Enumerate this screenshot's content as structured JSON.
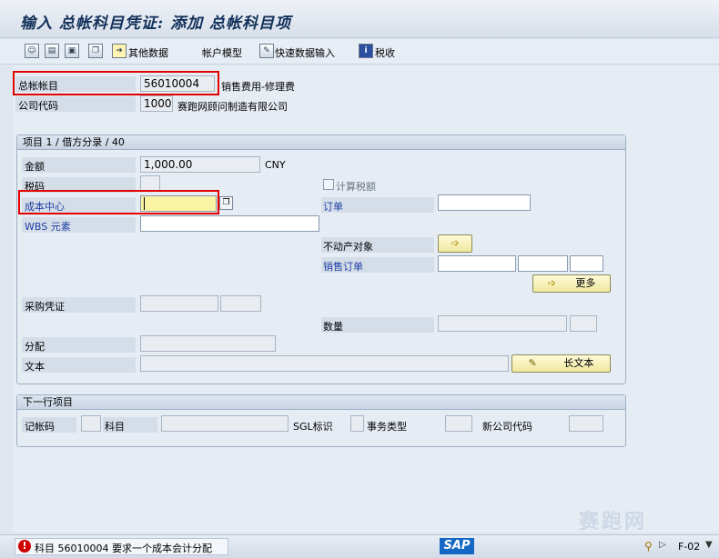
{
  "window": {
    "title": "输入 总帐科目凭证: 添加 总帐科目项"
  },
  "toolbar": {
    "other_data": "其他数据",
    "account_model": "帐户模型",
    "fast_entry": "快速数据输入",
    "tax": "税收"
  },
  "header": {
    "gl_account_label": "总帐帐目",
    "gl_account_value": "56010004",
    "gl_account_desc": "销售费用-修理费",
    "company_code_label": "公司代码",
    "company_code_value": "1000",
    "company_code_desc": "赛跑网顾问制造有限公司"
  },
  "item_group": {
    "title": "项目 1 / 借方分录 / 40",
    "amount_label": "金额",
    "amount_value": "1,000.00",
    "currency": "CNY",
    "tax_code_label": "税码",
    "calc_tax_label": "计算税额",
    "cost_center_label": "成本中心",
    "order_label": "订单",
    "wbs_label": "WBS 元素",
    "real_estate_label": "不动产对象",
    "sales_order_label": "销售订单",
    "more_label": "更多",
    "purchase_doc_label": "采购凭证",
    "quantity_label": "数量",
    "assignment_label": "分配",
    "text_label": "文本",
    "long_text_label": "长文本"
  },
  "next_item_group": {
    "title": "下一行项目",
    "posting_key_label": "记帐码",
    "account_label": "科目",
    "sgl_label": "SGL标识",
    "trans_type_label": "事务类型",
    "new_cc_label": "新公司代码"
  },
  "status": {
    "message": "科目 56010004 要求一个成本会计分配",
    "transaction": "F-02"
  },
  "logo": {
    "text": "SAP"
  },
  "watermark": {
    "text": "赛跑网"
  },
  "colors": {
    "error": "#e20000",
    "required_field": "#fbf3a4",
    "link_label": "#1d3ea6"
  }
}
